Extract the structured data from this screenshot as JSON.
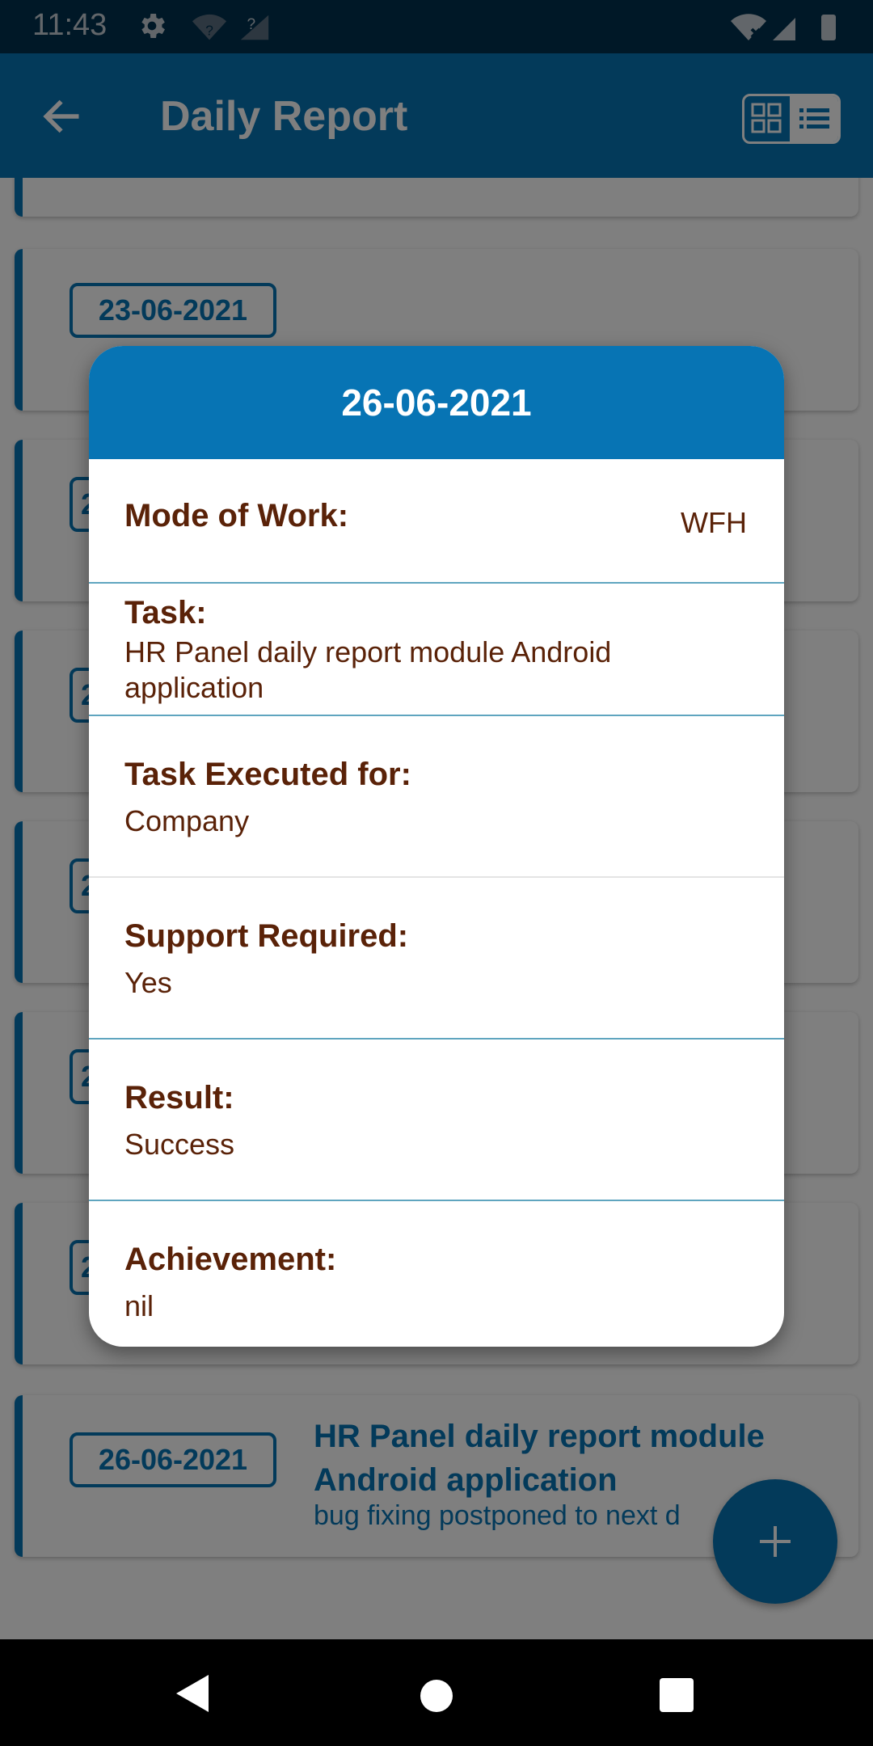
{
  "status_bar": {
    "time": "11:43",
    "icons": [
      "gear-icon",
      "wifi-unknown-icon",
      "signal-unknown-icon",
      "wifi-x-icon",
      "cell-signal-icon",
      "battery-icon"
    ]
  },
  "app_bar": {
    "title": "Daily Report",
    "back_icon": "arrow-left-icon",
    "view_toggle_icons": [
      "grid-view-icon",
      "list-view-icon"
    ]
  },
  "cards": [
    {
      "date": "",
      "title": "",
      "subtitle": ""
    },
    {
      "date": "23-06-2021",
      "title": "",
      "subtitle": ""
    },
    {
      "date": "2",
      "title": "",
      "subtitle": ""
    },
    {
      "date": "2",
      "title": "",
      "subtitle": ""
    },
    {
      "date": "2",
      "title": "",
      "subtitle": ""
    },
    {
      "date": "2",
      "title": "",
      "subtitle": ""
    },
    {
      "date": "2",
      "title": "",
      "subtitle": ""
    },
    {
      "date": "26-06-2021",
      "title": "HR Panel daily report module Android application",
      "subtitle": "bug fixing postponed to next d"
    }
  ],
  "dialog": {
    "title": "26-06-2021",
    "mode_of_work": {
      "label": "Mode of Work:",
      "value": "WFH"
    },
    "task": {
      "label": "Task:",
      "value": "HR Panel daily report module Android application"
    },
    "task_executed_for": {
      "label": "Task Executed for:",
      "value": "Company"
    },
    "support_required": {
      "label": "Support Required:",
      "value": "Yes"
    },
    "result": {
      "label": "Result:",
      "value": "Success"
    },
    "achievement": {
      "label": "Achievement:",
      "value": "nil"
    }
  },
  "fab": {
    "icon": "plus-icon"
  },
  "nav_bar": {
    "icons": [
      "nav-back-icon",
      "nav-home-icon",
      "nav-recents-icon"
    ]
  },
  "colors": {
    "primary": "#0774b4",
    "status_bar": "#01314f",
    "dialog_text": "#5a2208",
    "divider": "#5fa5bf"
  }
}
